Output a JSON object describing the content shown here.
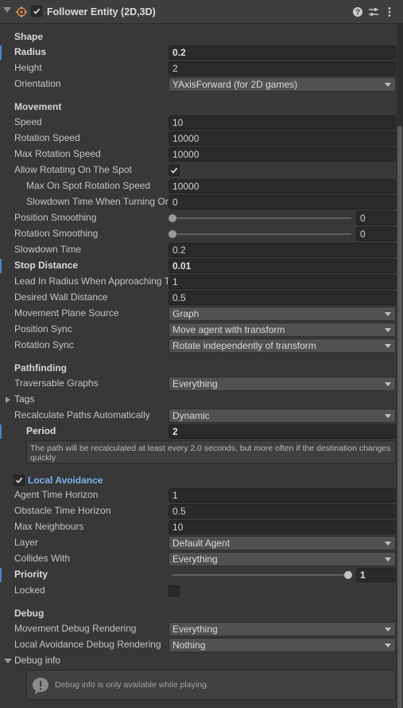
{
  "header": {
    "title": "Follower Entity (2D,3D)",
    "enabled": true,
    "icons": [
      "script-icon",
      "help-icon",
      "settings-icon",
      "more-icon"
    ]
  },
  "shape": {
    "title": "Shape",
    "radius_label": "Radius",
    "radius": "0.2",
    "height_label": "Height",
    "height": "2",
    "orientation_label": "Orientation",
    "orientation": "YAxisForward (for 2D games)"
  },
  "movement": {
    "title": "Movement",
    "speed_label": "Speed",
    "speed": "10",
    "rotation_speed_label": "Rotation Speed",
    "rotation_speed": "10000",
    "max_rotation_speed_label": "Max Rotation Speed",
    "max_rotation_speed": "10000",
    "allow_rotating_label": "Allow Rotating On The Spot",
    "allow_rotating": true,
    "max_on_spot_label": "Max On Spot Rotation Speed",
    "max_on_spot": "10000",
    "slowdown_turning_label": "Slowdown Time When Turning On The Spot",
    "slowdown_turning": "0",
    "position_smoothing_label": "Position Smoothing",
    "position_smoothing": "0",
    "rotation_smoothing_label": "Rotation Smoothing",
    "rotation_smoothing": "0",
    "slowdown_time_label": "Slowdown Time",
    "slowdown_time": "0.2",
    "stop_distance_label": "Stop Distance",
    "stop_distance": "0.01",
    "lead_in_radius_label": "Lead In Radius When Approaching Target",
    "lead_in_radius": "1",
    "desired_wall_label": "Desired Wall Distance",
    "desired_wall": "0.5",
    "plane_source_label": "Movement Plane Source",
    "plane_source": "Graph",
    "position_sync_label": "Position Sync",
    "position_sync": "Move agent with transform",
    "rotation_sync_label": "Rotation Sync",
    "rotation_sync": "Rotate independently of transform"
  },
  "pathfinding": {
    "title": "Pathfinding",
    "traversable_label": "Traversable Graphs",
    "traversable": "Everything",
    "tags_label": "Tags",
    "recalc_label": "Recalculate Paths Automatically",
    "recalc": "Dynamic",
    "period_label": "Period",
    "period": "2",
    "period_help": "The path will be recalculated at least every 2.0 seconds, but more often if the destination changes quickly"
  },
  "local_avoidance": {
    "title": "Local Avoidance",
    "enabled": true,
    "agent_time_label": "Agent Time Horizon",
    "agent_time": "1",
    "obstacle_time_label": "Obstacle Time Horizon",
    "obstacle_time": "0.5",
    "max_neighbours_label": "Max Neighbours",
    "max_neighbours": "10",
    "layer_label": "Layer",
    "layer": "Default Agent",
    "collides_label": "Collides With",
    "collides": "Everything",
    "priority_label": "Priority",
    "priority": "1",
    "locked_label": "Locked",
    "locked": false
  },
  "debug": {
    "title": "Debug",
    "movement_render_label": "Movement Debug Rendering",
    "movement_render": "Everything",
    "avoidance_render_label": "Local Avoidance Debug Rendering",
    "avoidance_render": "Nothing",
    "info_label": "Debug info",
    "info_text": "Debug info is only available while playing."
  },
  "colors": {
    "accent": "#4a84c8",
    "background": "#383838",
    "field": "#2a2a2a",
    "dropdown": "#515151",
    "link": "#7cb1f0"
  }
}
